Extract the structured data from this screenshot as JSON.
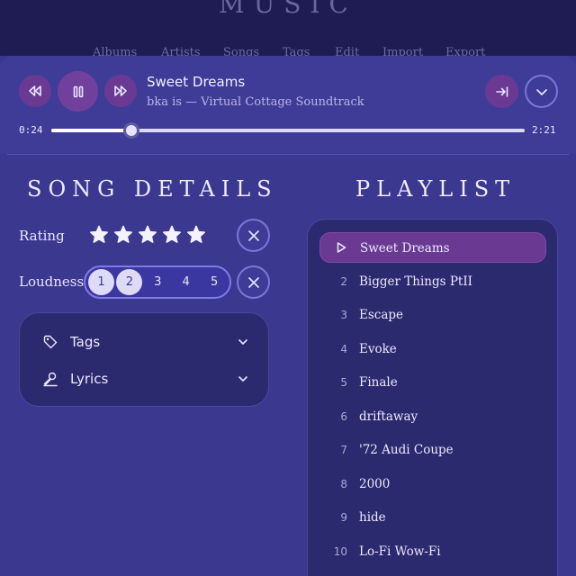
{
  "app": {
    "brand": "MUSIC",
    "nav": [
      "Albums",
      "Artists",
      "Songs",
      "Tags",
      "Edit",
      "Import",
      "Export"
    ]
  },
  "player": {
    "title": "Sweet Dreams",
    "subtitle": "bka is — Virtual Cottage Soundtrack",
    "current_time": "0:24",
    "total_time": "2:21",
    "progress_fraction": 0.17,
    "state": "playing"
  },
  "icons": {
    "rewind": "rewind-icon",
    "pause": "pause-icon",
    "fast_forward": "fast-forward-icon",
    "skip_to_end": "skip-to-end-icon",
    "collapse": "chevron-down-icon",
    "tag": "tag-icon",
    "lyrics": "microphone-icon"
  },
  "song_details": {
    "heading": "SONG DETAILS",
    "rating_label": "Rating",
    "rating_value": 5,
    "rating_max": 5,
    "loudness_label": "Loudness",
    "loudness_options": [
      "1",
      "2",
      "3",
      "4",
      "5"
    ],
    "loudness_selected": [
      "1",
      "2"
    ],
    "accordion": [
      {
        "label": "Tags",
        "icon": "tag-icon"
      },
      {
        "label": "Lyrics",
        "icon": "microphone-icon"
      }
    ]
  },
  "playlist": {
    "heading": "PLAYLIST",
    "items": [
      {
        "num": "",
        "title": "Sweet Dreams",
        "current": true
      },
      {
        "num": "2",
        "title": "Bigger Things PtII"
      },
      {
        "num": "3",
        "title": "Escape"
      },
      {
        "num": "4",
        "title": "Evoke"
      },
      {
        "num": "5",
        "title": "Finale"
      },
      {
        "num": "6",
        "title": "driftaway"
      },
      {
        "num": "7",
        "title": "'72 Audi Coupe"
      },
      {
        "num": "8",
        "title": "2000"
      },
      {
        "num": "9",
        "title": "hide"
      },
      {
        "num": "10",
        "title": "Lo-Fi Wow-Fi"
      }
    ]
  },
  "colors": {
    "background": "#3b3890",
    "header": "#1e1c52",
    "accent_purple": "#6a3a93",
    "panel": "#2c2a6e",
    "outline": "#7b77d6"
  }
}
